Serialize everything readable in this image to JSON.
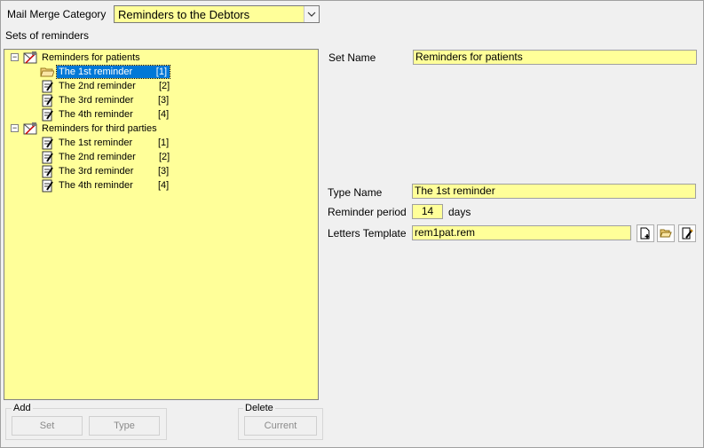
{
  "category": {
    "label": "Mail Merge Category",
    "value": "Reminders to the Debtors"
  },
  "sets_label": "Sets of reminders",
  "tree": {
    "groups": [
      {
        "name": "Reminders for patients",
        "children": [
          {
            "name": "The 1st reminder",
            "key": "[1]"
          },
          {
            "name": "The 2nd reminder",
            "key": "[2]"
          },
          {
            "name": "The 3rd reminder",
            "key": "[3]"
          },
          {
            "name": "The 4th reminder",
            "key": "[4]"
          }
        ]
      },
      {
        "name": "Reminders for third parties",
        "children": [
          {
            "name": "The 1st reminder",
            "key": "[1]"
          },
          {
            "name": "The 2nd reminder",
            "key": "[2]"
          },
          {
            "name": "The 3rd reminder",
            "key": "[3]"
          },
          {
            "name": "The 4th reminder",
            "key": "[4]"
          }
        ]
      }
    ]
  },
  "details": {
    "set_name_label": "Set Name",
    "set_name_value": "Reminders for patients",
    "type_name_label": "Type Name",
    "type_name_value": "The 1st reminder",
    "period_label": "Reminder period",
    "period_value": "14",
    "period_unit": "days",
    "template_label": "Letters Template",
    "template_value": "rem1pat.rem"
  },
  "add_group": {
    "title": "Add",
    "set_label": "Set",
    "type_label": "Type"
  },
  "delete_group": {
    "title": "Delete",
    "current_label": "Current"
  }
}
